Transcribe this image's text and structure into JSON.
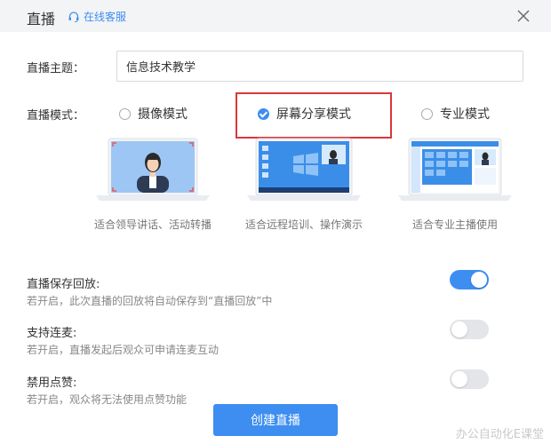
{
  "dialog": {
    "title": "直播",
    "service_label": "在线客服",
    "service_icon": "headset-icon",
    "close_icon": "close-icon"
  },
  "topic": {
    "label": "直播主题：",
    "value": "信息技术教学"
  },
  "mode": {
    "label": "直播模式：",
    "options": [
      {
        "label": "摄像模式",
        "caption": "适合领导讲话、活动转播",
        "selected": false
      },
      {
        "label": "屏幕分享模式",
        "caption": "适合远程培训、操作演示",
        "selected": true
      },
      {
        "label": "专业模式",
        "caption": "适合专业主播使用",
        "selected": false
      }
    ]
  },
  "settings": [
    {
      "title": "直播保存回放:",
      "desc": "若开启，此次直播的回放将自动保存到“直播回放”中",
      "enabled": true
    },
    {
      "title": "支持连麦:",
      "desc": "若开启，直播发起后观众可申请连麦互动",
      "enabled": false
    },
    {
      "title": "禁用点赞:",
      "desc": "若开启，观众将无法使用点赞功能",
      "enabled": false
    }
  ],
  "create_button": "创建直播",
  "watermark": "办公自动化E课堂",
  "colors": {
    "accent": "#3d8ef0",
    "highlight_border": "#d9383a",
    "toggle_off": "#e3e5e8",
    "header_bg": "#f3f4f6"
  }
}
